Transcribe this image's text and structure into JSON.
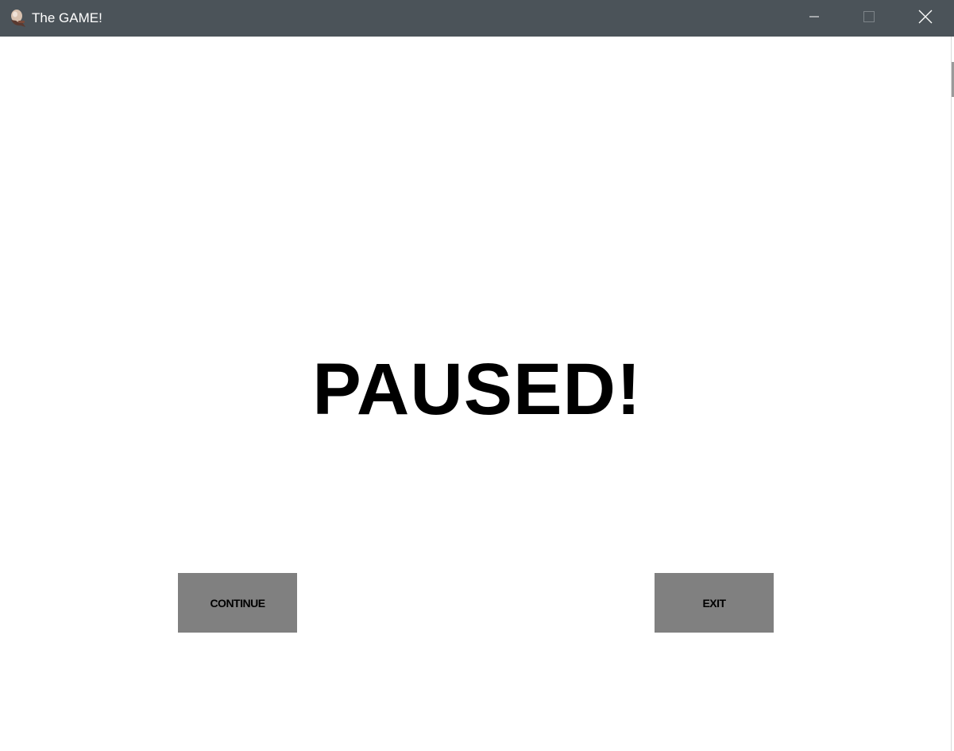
{
  "window": {
    "title": "The GAME!",
    "app_icon": "game-avatar-icon",
    "controls": {
      "minimize_icon": "minimize-icon",
      "maximize_icon": "maximize-icon",
      "close_icon": "close-icon"
    },
    "titlebar_color": "#4b5359"
  },
  "pause_screen": {
    "heading": "PAUSED!",
    "buttons": {
      "continue_label": "CONTINUE",
      "exit_label": "EXIT"
    },
    "button_color": "#808080",
    "background_color": "#ffffff"
  }
}
